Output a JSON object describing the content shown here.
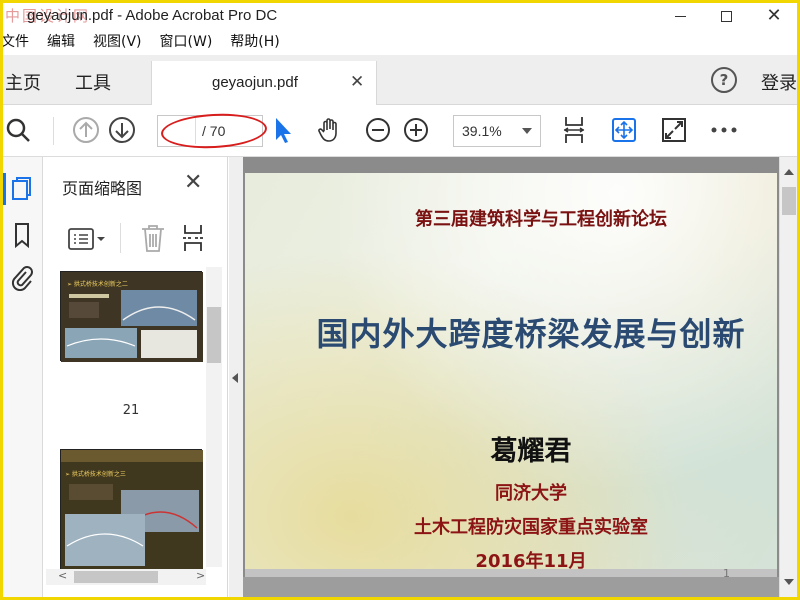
{
  "window": {
    "watermark": "中国设计网",
    "title": "geyaojun.pdf - Adobe Acrobat Pro DC"
  },
  "menu": [
    "文件",
    "编辑",
    "视图(V)",
    "窗口(W)",
    "帮助(H)"
  ],
  "tabs": {
    "home": "主页",
    "tools": "工具",
    "document": "geyaojun.pdf",
    "login": "登录"
  },
  "toolbar": {
    "page_total": "/ 70",
    "zoom": "39.1%"
  },
  "thumbnails": {
    "title": "页面缩略图",
    "pages": [
      {
        "label": "21"
      }
    ]
  },
  "slide": {
    "conference": "第三届建筑科学与工程创新论坛",
    "title": "国内外大跨度桥梁发展与创新",
    "author": "葛耀君",
    "university": "同济大学",
    "lab": "土木工程防灾国家重点实验室",
    "date": "2016年11月",
    "page_number": "1"
  },
  "colors": {
    "accent_blue": "#1a73e8",
    "annotation_red": "#d81d1d",
    "conference_red": "#7a1212",
    "title_blue": "#2a4a72"
  }
}
